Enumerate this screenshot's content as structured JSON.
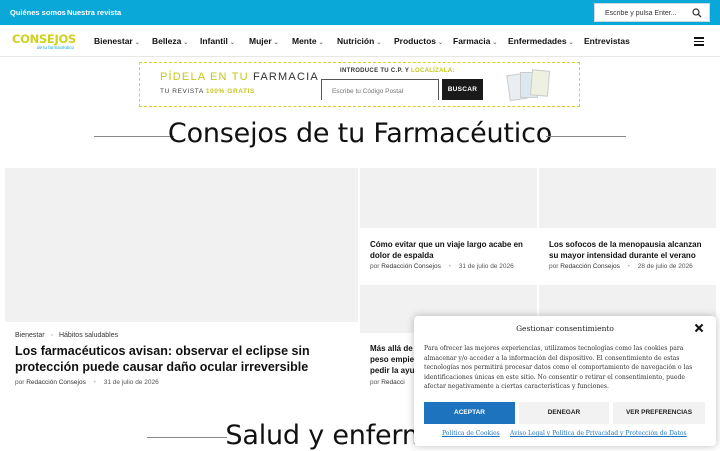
{
  "topbar": {
    "links": [
      "Quiénes somos",
      "Nuestra revista"
    ],
    "search_placeholder": "Escribe y pulsa Enter...",
    "search_icon": "search-icon",
    "bg_color": "#0aa8d9"
  },
  "logo": {
    "word": "CONSEJOS",
    "sub": "de tu farmacéutico"
  },
  "nav": {
    "items": [
      {
        "label": "Bienestar",
        "has_submenu": true
      },
      {
        "label": "Belleza",
        "has_submenu": true
      },
      {
        "label": "Infantil",
        "has_submenu": true
      },
      {
        "label": "Mujer",
        "has_submenu": true
      },
      {
        "label": "Mente",
        "has_submenu": true
      },
      {
        "label": "Nutrición",
        "has_submenu": true
      },
      {
        "label": "Productos",
        "has_submenu": true
      },
      {
        "label": "Farmacia",
        "has_submenu": true
      },
      {
        "label": "Enfermedades",
        "has_submenu": true
      },
      {
        "label": "Entrevistas",
        "has_submenu": false
      }
    ],
    "chevron": "⌄",
    "menu_icon": "hamburger-icon"
  },
  "banner": {
    "title_part1": "PÍDELA EN TU",
    "title_part2": "FARMACIA",
    "sub_part1": "TU REVISTA",
    "sub_part2": "100% GRATIS",
    "intro_part1": "INTRODUCE TU C.P. Y",
    "intro_part2": "LOCALÍZALA:",
    "input_placeholder": "Escribe tu Código Postal",
    "button": "BUSCAR",
    "accent_color": "#c6c718"
  },
  "section1": {
    "title": "Consejos de tu Farmacéutico"
  },
  "featured": {
    "tags": [
      "Bienestar",
      "Hábitos saludables"
    ],
    "title": "Los farmacéuticos avisan: observar el eclipse sin protección puede causar daño ocular irreversible",
    "by": "por",
    "author": "Redacción Consejos",
    "date": "31 de julio de 2026"
  },
  "cards": [
    {
      "title": "Cómo evitar que un viaje largo acabe en dolor de espalda",
      "by": "por",
      "author": "Redacción Consejos",
      "date": "31 de julio de 2026"
    },
    {
      "title": "Los sofocos de la menopausia alcanzan su mayor intensidad durante el verano",
      "by": "por",
      "author": "Redacción Consejos",
      "date": "28 de julio de 2026"
    },
    {
      "title_line1": "Más allá de l",
      "title_line2": "peso empiez",
      "title_line3": "pedir la ayud",
      "by": "por",
      "author": "Redacci"
    }
  ],
  "section2": {
    "title": "Salud y enfermedad"
  },
  "cookie": {
    "title": "Gestionar consentimiento",
    "text": "Para ofrecer las mejores experiencias, utilizamos tecnologías como las cookies para almacenar y/o acceder a la información del dispositivo. El consentimiento de estas tecnologías nos permitirá procesar datos como el comportamiento de navegación o las identificaciones únicas en este sitio. No consentir o retirar el consentimiento, puede afectar negativamente a ciertas características y funciones.",
    "accept": "ACEPTAR",
    "deny": "DENEGAR",
    "prefs": "VER PREFERENCIAS",
    "link1": "Política de Cookies",
    "link2": "Aviso Legal y Política de Privacidad y Protección de Datos",
    "accent_color": "#1e73be",
    "close_icon": "close-icon"
  }
}
